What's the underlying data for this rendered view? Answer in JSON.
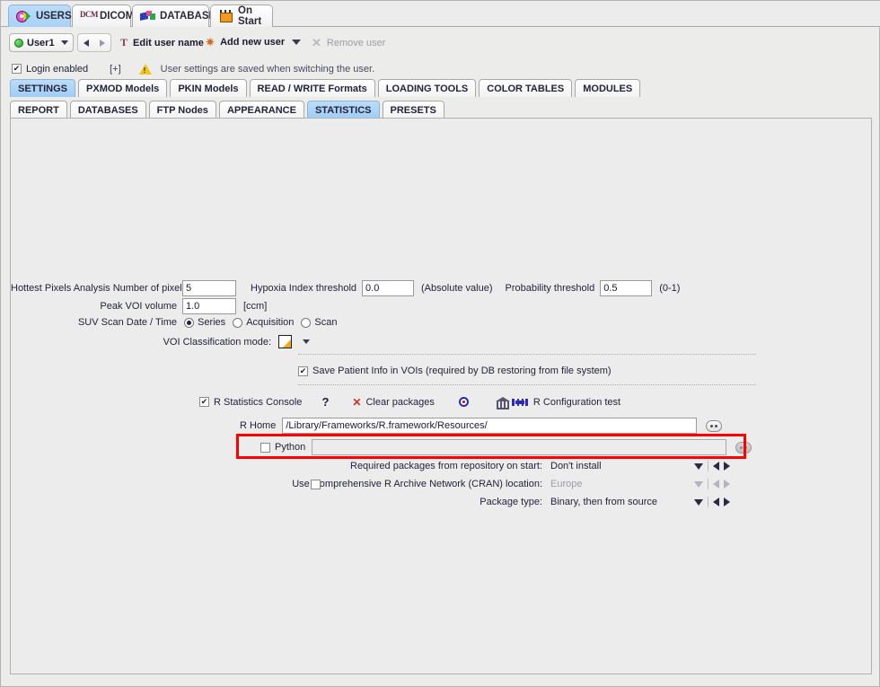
{
  "top_tabs": [
    {
      "label": "USERS",
      "icon": "users-icon",
      "selected": true
    },
    {
      "label": "DICOM",
      "icon": "dcm-icon",
      "selected": false
    },
    {
      "label": "DATABASE",
      "icon": "database-icon",
      "selected": false
    },
    {
      "label": "On Start",
      "icon": "on-start-icon",
      "selected": false
    }
  ],
  "userbar": {
    "user_value": "User1",
    "edit_user_label": "Edit user name",
    "add_user_label": "Add new user",
    "remove_user_label": "Remove user"
  },
  "login": {
    "checkbox_label": "Login enabled",
    "checked": true,
    "expand_label": "[+]",
    "warning_text": "User settings are saved when switching the user."
  },
  "tabs_level2": [
    {
      "label": "SETTINGS",
      "selected": true
    },
    {
      "label": "PXMOD Models",
      "selected": false
    },
    {
      "label": "PKIN Models",
      "selected": false
    },
    {
      "label": "READ / WRITE Formats",
      "selected": false
    },
    {
      "label": "LOADING TOOLS",
      "selected": false
    },
    {
      "label": "COLOR TABLES",
      "selected": false
    },
    {
      "label": "MODULES",
      "selected": false
    }
  ],
  "tabs_level3": [
    {
      "label": "REPORT",
      "selected": false
    },
    {
      "label": "DATABASES",
      "selected": false
    },
    {
      "label": "FTP Nodes",
      "selected": false
    },
    {
      "label": "APPEARANCE",
      "selected": false
    },
    {
      "label": "STATISTICS",
      "selected": true
    },
    {
      "label": "PRESETS",
      "selected": false
    }
  ],
  "settings": {
    "hottest_pixels_label": "Hottest Pixels Analysis Number of pixels",
    "hottest_pixels_value": "5",
    "hypoxia_label": "Hypoxia Index threshold",
    "hypoxia_value": "0.0",
    "hypoxia_note": "(Absolute value)",
    "probability_label": "Probability threshold",
    "probability_value": "0.5",
    "probability_note": "(0-1)",
    "peak_voi_label": "Peak VOI volume",
    "peak_voi_value": "1.0",
    "peak_voi_unit": "[ccm]",
    "suv_label": "SUV Scan Date / Time",
    "suv_options": [
      {
        "label": "Series",
        "selected": true
      },
      {
        "label": "Acquisition",
        "selected": false
      },
      {
        "label": "Scan",
        "selected": false
      }
    ],
    "voi_class_label": "VOI Classification mode:",
    "voi_class_icon": "gradient-swatch-icon",
    "save_patient_label": "Save Patient Info in VOIs (required by DB restoring from file system)",
    "save_patient_checked": true,
    "r_console_label": "R Statistics Console",
    "r_console_checked": true,
    "help_label": "?",
    "clear_packages_label": "Clear packages",
    "target_icon": "target-icon",
    "r_config_test_label": "R Configuration test",
    "r_home_label": "R Home",
    "r_home_value": "/Library/Frameworks/R.framework/Resources/",
    "python_label": "Python",
    "python_checked": false,
    "python_value": "",
    "required_packages_label": "Required packages from repository on start:",
    "required_packages_value": "Don't install",
    "cran_label": "Use Comprehensive R Archive Network (CRAN) location:",
    "cran_checked": false,
    "cran_value": "Europe",
    "package_type_label": "Package type:",
    "package_type_value": "Binary, then from source"
  },
  "colors": {
    "tab_selected": "#a8d2f7",
    "highlight_box": "#ff0000",
    "panel_bg": "#ececec",
    "warning_yellow": "#f2c51c"
  }
}
